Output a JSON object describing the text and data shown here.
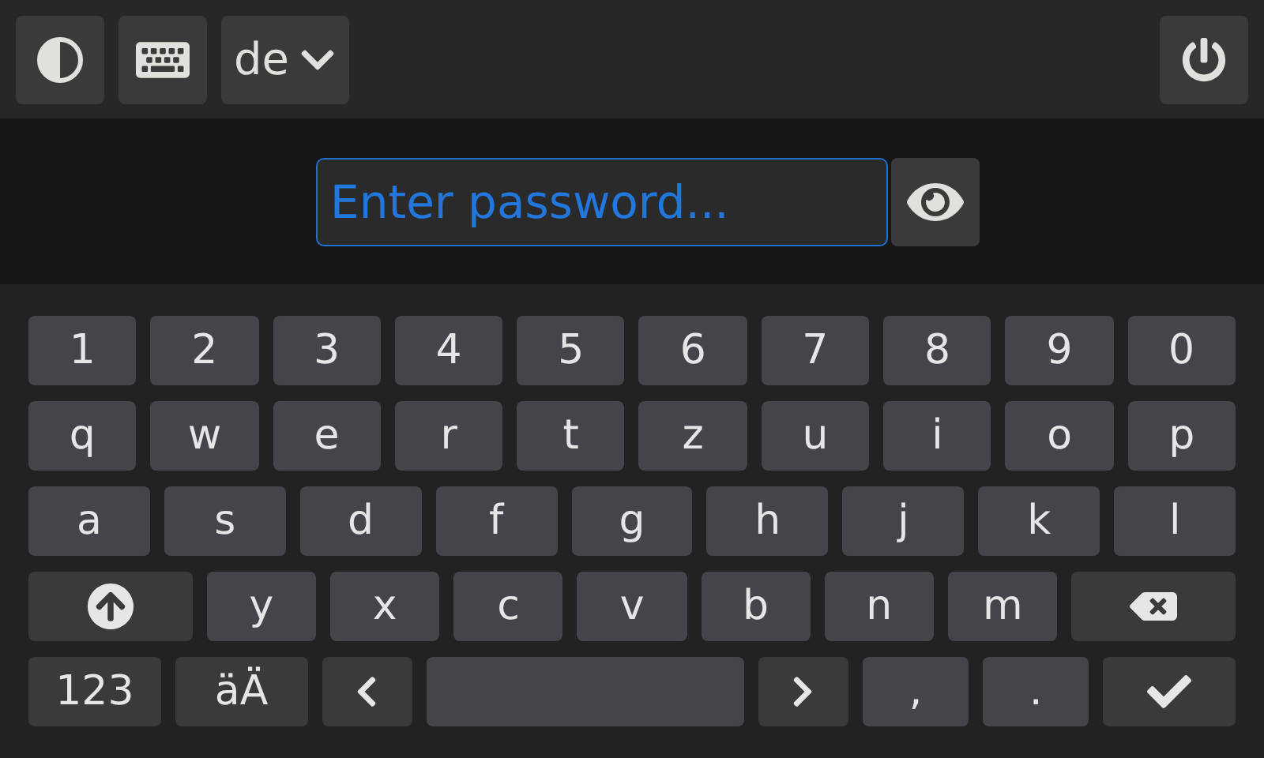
{
  "top_bar": {
    "language": "de"
  },
  "password_field": {
    "placeholder": "Enter password..."
  },
  "keyboard": {
    "rows": [
      {
        "keys": [
          {
            "kind": "char",
            "label": "1"
          },
          {
            "kind": "char",
            "label": "2"
          },
          {
            "kind": "char",
            "label": "3"
          },
          {
            "kind": "char",
            "label": "4"
          },
          {
            "kind": "char",
            "label": "5"
          },
          {
            "kind": "char",
            "label": "6"
          },
          {
            "kind": "char",
            "label": "7"
          },
          {
            "kind": "char",
            "label": "8"
          },
          {
            "kind": "char",
            "label": "9"
          },
          {
            "kind": "char",
            "label": "0"
          }
        ]
      },
      {
        "keys": [
          {
            "kind": "char",
            "label": "q"
          },
          {
            "kind": "char",
            "label": "w"
          },
          {
            "kind": "char",
            "label": "e"
          },
          {
            "kind": "char",
            "label": "r"
          },
          {
            "kind": "char",
            "label": "t"
          },
          {
            "kind": "char",
            "label": "z"
          },
          {
            "kind": "char",
            "label": "u"
          },
          {
            "kind": "char",
            "label": "i"
          },
          {
            "kind": "char",
            "label": "o"
          },
          {
            "kind": "char",
            "label": "p"
          }
        ]
      },
      {
        "keys": [
          {
            "kind": "char",
            "label": "a"
          },
          {
            "kind": "char",
            "label": "s"
          },
          {
            "kind": "char",
            "label": "d"
          },
          {
            "kind": "char",
            "label": "f"
          },
          {
            "kind": "char",
            "label": "g"
          },
          {
            "kind": "char",
            "label": "h"
          },
          {
            "kind": "char",
            "label": "j"
          },
          {
            "kind": "char",
            "label": "k"
          },
          {
            "kind": "char",
            "label": "l"
          }
        ]
      },
      {
        "keys": [
          {
            "kind": "shift"
          },
          {
            "kind": "char",
            "label": "y"
          },
          {
            "kind": "char",
            "label": "x"
          },
          {
            "kind": "char",
            "label": "c"
          },
          {
            "kind": "char",
            "label": "v"
          },
          {
            "kind": "char",
            "label": "b"
          },
          {
            "kind": "char",
            "label": "n"
          },
          {
            "kind": "char",
            "label": "m"
          },
          {
            "kind": "backspace"
          }
        ]
      },
      {
        "keys": [
          {
            "kind": "mode",
            "label": "123"
          },
          {
            "kind": "mode",
            "label": "äÄ"
          },
          {
            "kind": "left"
          },
          {
            "kind": "space"
          },
          {
            "kind": "right"
          },
          {
            "kind": "char",
            "label": ","
          },
          {
            "kind": "char",
            "label": "."
          },
          {
            "kind": "enter"
          }
        ]
      }
    ]
  }
}
